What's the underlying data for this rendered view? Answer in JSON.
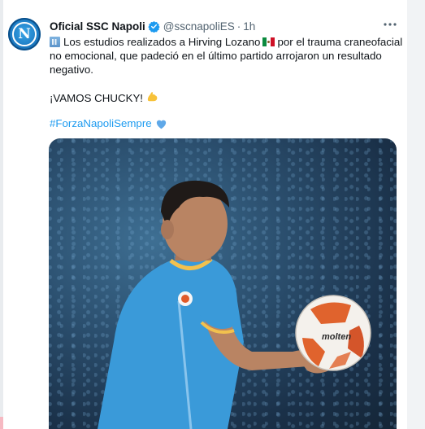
{
  "tweet": {
    "author_name": "Oficial SSC Napoli",
    "handle": "@sscnapoliES",
    "separator": "·",
    "time": "1h",
    "avatar_letter": "N",
    "text_lines": [
      "Los estudios realizados a Hirving Lozano",
      "por el trauma craneofacial",
      "no emocional, que padeció en el último partido arrojaron un resultado",
      "negativo.",
      "¡VAMOS CHUCKY!"
    ],
    "hashtag": "#ForzaNapoliSempre",
    "icons": {
      "verified": "verified-badge-icon",
      "building": "hospital-emoji-icon",
      "flag": "mexico-flag-emoji-icon",
      "muscle": "flexed-biceps-emoji-icon",
      "heart": "blue-heart-emoji-icon",
      "more": "more-options-icon"
    }
  },
  "media": {
    "ball_brand": "molten"
  },
  "colors": {
    "accent": "#1d9bf0",
    "verified": "#1d9bf0",
    "text": "#0f1419",
    "muted": "#536471",
    "jersey": "#3a9ad9",
    "heart": "#5fa8e8"
  }
}
